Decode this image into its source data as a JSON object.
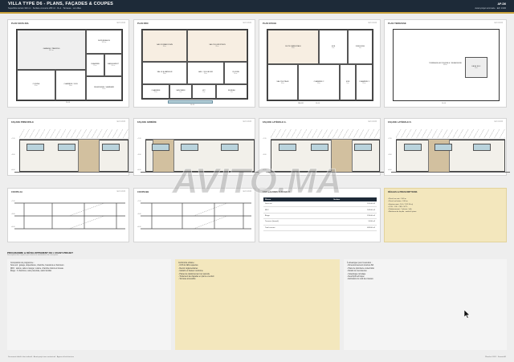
{
  "header": {
    "title": "VILLA TYPE D6 - PLANS, FAÇADES & COUPES",
    "subtitle": "Superficie terrain 320 m² · Surface couverte 280 m² · R+1 · Terrasse · Lot villas",
    "ref": "AP-D6",
    "ref_sub": "Avant-projet sommaire · Ech 1/100"
  },
  "plans": [
    {
      "title": "PLAN SOUS-SOL",
      "right": "Ech 1/100",
      "rooms": [
        {
          "label": "GARAGE / PARKING",
          "area": "38.5 m²"
        },
        {
          "label": "DEPENDANCE",
          "area": "18.2 m²"
        },
        {
          "label": "CHAMBRE",
          "area": "12 m²"
        },
        {
          "label": "RANGEMENT",
          "area": "8.4 m²"
        },
        {
          "label": "CUISINE",
          "area": "10 m²"
        },
        {
          "label": "CHAMBRE / SDB",
          "area": "14 m²"
        },
        {
          "label": "BUANDERIE / HAMMAM",
          "area": "16 m²"
        }
      ],
      "dim": "14.00"
    },
    {
      "title": "PLAN RDC",
      "right": "Ech 1/100",
      "rooms": [
        {
          "label": "SALON MAROCAIN",
          "area": "36 m²"
        },
        {
          "label": "SALON EUROPEEN",
          "area": "32 m²"
        },
        {
          "label": "SALLE A MANGER",
          "area": "18 m²"
        },
        {
          "label": "HALL / ESCALIER",
          "area": "12 m²"
        },
        {
          "label": "CUISINE",
          "area": "14 m²"
        },
        {
          "label": "CHAMBRE",
          "area": "12 m²"
        },
        {
          "label": "SANITAIRE",
          "area": "4 m²"
        },
        {
          "label": "WC",
          "area": "2 m²"
        },
        {
          "label": "BUREAU",
          "area": "9 m²"
        }
      ],
      "dim": "14.00"
    },
    {
      "title": "PLAN ETAGE",
      "right": "Ech 1/100",
      "rooms": [
        {
          "label": "SUITE PARENTALE",
          "area": "24 m²"
        },
        {
          "label": "SDB",
          "area": "6 m²"
        },
        {
          "label": "DRESSING",
          "area": "5 m²"
        },
        {
          "label": "SALON ETAGE",
          "area": "16 m²"
        },
        {
          "label": "CHAMBRE 2",
          "area": "14 m²"
        },
        {
          "label": "SDB",
          "area": "5 m²"
        },
        {
          "label": "CHAMBRE 3",
          "area": "13 m²"
        },
        {
          "label": "PALIER",
          "area": "8 m²"
        }
      ],
      "dim": "14.00"
    },
    {
      "title": "PLAN TERRASSE",
      "right": "Ech 1/100",
      "rooms": [
        {
          "label": "TERRASSE ACCESSIBLE / BUANDERIE",
          "area": "168 m²"
        },
        {
          "label": "CAGE ESC.",
          "area": "14 m²"
        }
      ],
      "dim": "14.00"
    }
  ],
  "facades": [
    {
      "title": "FAÇADE PRINCIPALE",
      "right": "Ech 1/100"
    },
    {
      "title": "FAÇADE ARRIÈRE",
      "right": "Ech 1/100"
    },
    {
      "title": "FAÇADE LATÉRALE G.",
      "right": "Ech 1/100"
    },
    {
      "title": "FAÇADE LATÉRALE D.",
      "right": "Ech 1/100"
    }
  ],
  "levels": [
    "+7.20",
    "+3.60",
    "±0.00"
  ],
  "sections": [
    {
      "title": "COUPE AA",
      "right": "Ech 1/100"
    },
    {
      "title": "COUPE BB",
      "right": "Ech 1/100"
    }
  ],
  "schedule": {
    "title": "TABLEAU DES SURFACES",
    "headers": [
      "Niveau",
      "Surface"
    ],
    "rows": [
      [
        "Sous-sol",
        "120.00 m²"
      ],
      [
        "RDC",
        "140.00 m²"
      ],
      [
        "Étage",
        "135.00 m²"
      ],
      [
        "Terrasse (buand.)",
        "14.00 m²"
      ],
      [
        "Total couvert",
        "409.00 m²"
      ]
    ]
  },
  "rules": {
    "title": "RÈGLES & PRESCRIPTIONS",
    "items": [
      "• Recul sur voie : 5.00 m",
      "• Recul sur limites : 3.00 m",
      "• Hauteur maxi : R+1+T (11.50 m)",
      "• COS : 1.30 · CES : 50 %",
      "• Stationnement : 2 places / villa",
      "• Matériaux de façade : enduit & pierre"
    ]
  },
  "program": {
    "title": "PROGRAMME & DÉVELOPPEMENT DE L'AVANT-PROJET",
    "subtitle": "Description des espaces par niveau et orientations de conception",
    "columns": [
      [
        "Composition du programme :",
        "Sous-sol : garage, dépendance, chambre, buanderie et hammam.",
        "RDC : salons, salle à manger, cuisine, chambre d'amis et bureau.",
        "Étage : 3 chambres, suite parentale, salon familial."
      ],
      [
        "Conformité urbaine :",
        "- COS & CES respectés",
        "- Reculs réglementaires",
        "- Gabarit en hauteur conforme",
        "- Places de stationnement sur parcelle",
        "- Traitement des façades en pierre et enduit",
        "- Terrasse accessible"
      ],
      [
        "À développer pour l'exécution :",
        "- Dimensionnement structure BA",
        "- Plans de plomberie et électricité",
        "- Détails de menuiseries",
        "- Calepinage carrelage",
        "- Descriptif technique",
        "- Estimation du coût des travaux"
      ]
    ]
  },
  "footer": {
    "left": "Document établi à titre indicatif · Avant-projet non contractuel · Agence d'architecture",
    "right": "Planche 01/01 · Format A1"
  },
  "watermark": "AVITO.MA",
  "colors": {
    "navy": "#1d2a38",
    "gold": "#c9a23c",
    "beige": "#f3e7bd",
    "tint": "#f7eee2",
    "glass": "#b9d3dc",
    "door": "#d2c09f"
  }
}
